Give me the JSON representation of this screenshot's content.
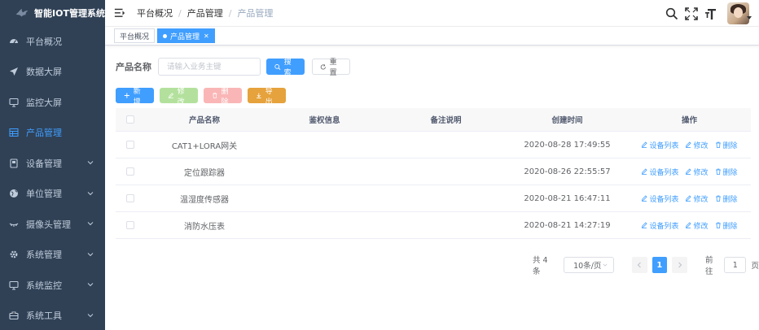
{
  "app": {
    "title": "智能IOT管理系统"
  },
  "sidebar": {
    "items": [
      {
        "label": "平台概况",
        "icon": "dashboard-icon",
        "active": false,
        "expandable": false
      },
      {
        "label": "数据大屏",
        "icon": "send-icon",
        "active": false,
        "expandable": false
      },
      {
        "label": "监控大屏",
        "icon": "monitor-icon",
        "active": false,
        "expandable": false
      },
      {
        "label": "产品管理",
        "icon": "grid-icon",
        "active": true,
        "expandable": false
      },
      {
        "label": "设备管理",
        "icon": "device-icon",
        "active": false,
        "expandable": true
      },
      {
        "label": "单位管理",
        "icon": "globe-icon",
        "active": false,
        "expandable": true
      },
      {
        "label": "摄像头管理",
        "icon": "camera-icon",
        "active": false,
        "expandable": true
      },
      {
        "label": "系统管理",
        "icon": "gear-icon",
        "active": false,
        "expandable": true
      },
      {
        "label": "系统监控",
        "icon": "monitor-icon",
        "active": false,
        "expandable": true
      },
      {
        "label": "系统工具",
        "icon": "toolbox-icon",
        "active": false,
        "expandable": true
      }
    ]
  },
  "breadcrumb": {
    "items": [
      "平台概况",
      "产品管理",
      "产品管理"
    ],
    "separator": "/"
  },
  "tags": {
    "items": [
      "平台概况",
      "产品管理"
    ]
  },
  "search": {
    "label": "产品名称",
    "placeholder": "请输入业务主键",
    "search_label": "搜索",
    "reset_label": "重置"
  },
  "actions": {
    "add": "新增",
    "edit": "修改",
    "delete": "删除",
    "export": "导出"
  },
  "table": {
    "columns": [
      "产品名称",
      "鉴权信息",
      "备注说明",
      "创建时间",
      "操作"
    ],
    "rows": [
      {
        "name": "CAT1+LORA网关",
        "auth": "",
        "remark": "",
        "created": "2020-08-28 17:49:55"
      },
      {
        "name": "定位跟踪器",
        "auth": "",
        "remark": "",
        "created": "2020-08-26 22:55:57"
      },
      {
        "name": "温湿度传感器",
        "auth": "",
        "remark": "",
        "created": "2020-08-21 16:47:11"
      },
      {
        "name": "消防水压表",
        "auth": "",
        "remark": "",
        "created": "2020-08-21 14:27:19"
      }
    ],
    "ops": {
      "device_list": "设备列表",
      "edit": "修改",
      "delete": "删除"
    }
  },
  "pager": {
    "total": "共 4 条",
    "page_size": "10条/页",
    "current_page": "1",
    "goto_label": "前往",
    "goto_value": "1",
    "page_suffix": "页"
  },
  "colors": {
    "primary": "#409eff",
    "sidebar_bg": "#304156",
    "sidebar_text": "#bfcbd9",
    "warning": "#e6a23c"
  }
}
